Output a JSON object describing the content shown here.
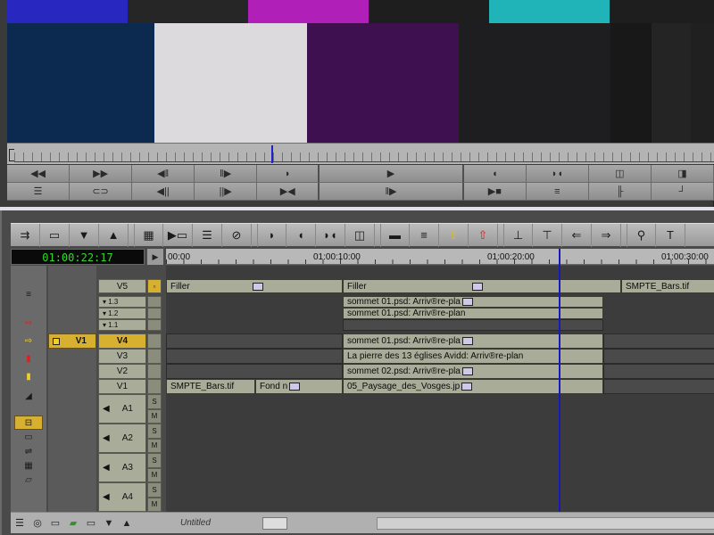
{
  "monitor": {
    "bars_top_colors": [
      "#2828c0",
      "#262626",
      "#b020b8",
      "#1e1e1e",
      "#20b4b8",
      "#1e1e1e"
    ],
    "bars_main_colors": [
      "#0c2a50",
      "#dcdadc",
      "#3e1050",
      "#1e1e20",
      "#181818",
      "#242424",
      "#202020"
    ],
    "row1_icons": [
      "rewind-icon",
      "fast-forward-icon",
      "step-back-icon",
      "step-forward-icon",
      "mark-out-icon",
      "play-icon",
      "mark-in-icon",
      "mark-clip-icon",
      "mark-split-icon",
      "mark-end-icon"
    ],
    "row1_glyphs": [
      "◀◀",
      "▶▶",
      "◀‖",
      "‖▶",
      "◗",
      "▶",
      "◖",
      "◗◖",
      "◫",
      "◨"
    ],
    "row2_glyphs": [
      "☰",
      "⊂⊃",
      "◀||",
      "||▶",
      "▶◀",
      "‖▶",
      "▶■",
      "≡",
      "╟",
      "┘"
    ]
  },
  "timeline": {
    "toolbar_glyphs": [
      "⇉",
      "▭",
      "▼",
      "▲",
      "▦",
      "▶▭",
      "☰",
      "⊘",
      "◗",
      "◖",
      "◗◖",
      "◫",
      "▬",
      "≡",
      "⇧",
      "⇧",
      "⊥",
      "⊤",
      "⇐",
      "⇒",
      "⚲",
      "T"
    ],
    "timecode": "01:00:22:17",
    "ruler_labels": [
      "00:00",
      "01:00:10:00",
      "01:00:20:00",
      "01:00:30:00"
    ],
    "left_tools": [
      "≡",
      "⇨",
      "⇨",
      "▮",
      "▮",
      "◢",
      "⊟",
      "▭",
      "⇌",
      "▦",
      "▱"
    ],
    "tracks": {
      "v5": "V5",
      "t13": "▾ 1.3",
      "t12": "▾ 1.2",
      "t11": "▾ 1.1",
      "v4": "V4",
      "v3": "V3",
      "v2": "V2",
      "v1": "V1",
      "a1": "A1",
      "a2": "A2",
      "a3": "A3",
      "a4": "A4",
      "src_v1": "V1",
      "s": "S",
      "m": "M"
    },
    "clips": {
      "v5_filler_1": "Filler",
      "v5_filler_2": "Filler",
      "v5_smpte": "SMPTE_Bars.tif",
      "t13_clip": "sommet 01.psd: Arriv®re-pla",
      "t12_clip": "sommet 01.psd: Arriv®re-plan",
      "v4_clip": "sommet 01.psd: Arriv®re-pla",
      "v3_clip": "La pierre des 13 églises Avid",
      "v3_clip_b": "d: Arriv®re-plan",
      "v2_clip": "sommet 02.psd: Arriv®re-pla",
      "v1_smpte": "SMPTE_Bars.tif",
      "v1_fond": "Fond n",
      "v1_paysage": "05_Paysage_des_Vosges.jp"
    },
    "status": {
      "title": "Untitled"
    },
    "playhead_color": "#1818c0"
  }
}
